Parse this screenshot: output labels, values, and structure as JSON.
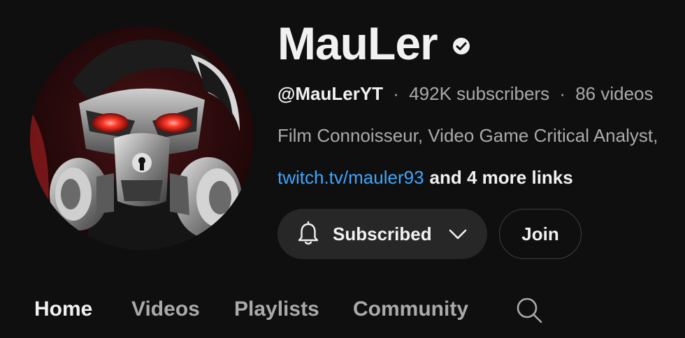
{
  "channel": {
    "name": "MauLer",
    "handle": "@MauLerYT",
    "subscribers": "492K subscribers",
    "videos": "86 videos",
    "separator": "·",
    "description": "Film Connoisseur, Video Game Critical Analyst,",
    "primary_link": "twitch.tv/mauler93",
    "more_links": "and 4 more links"
  },
  "actions": {
    "subscribe_label": "Subscribed",
    "join_label": "Join"
  },
  "tabs": [
    {
      "label": "Home",
      "active": true
    },
    {
      "label": "Videos",
      "active": false
    },
    {
      "label": "Playlists",
      "active": false
    },
    {
      "label": "Community",
      "active": false
    }
  ],
  "icons": {
    "verified": "verified-check-icon",
    "bell": "bell-icon",
    "chevron": "chevron-down-icon",
    "search": "search-icon"
  },
  "colors": {
    "background": "#0f0f0f",
    "text_primary": "#f1f1f1",
    "text_secondary": "#aaaaaa",
    "link": "#3ea6ff",
    "button_bg": "#272727",
    "button_border": "#3f3f3f"
  }
}
